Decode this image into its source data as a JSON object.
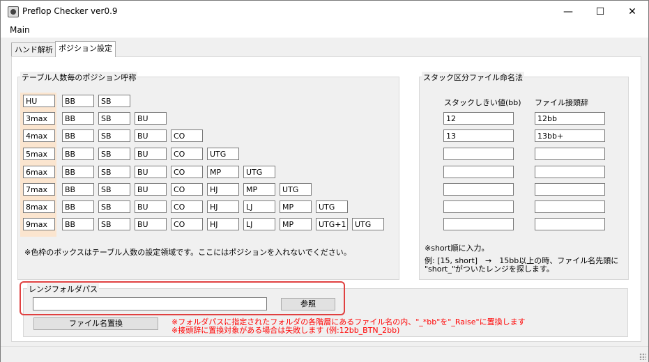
{
  "window": {
    "title": "Preflop Checker ver0.9",
    "minimize": "—",
    "maximize": "☐",
    "close": "✕"
  },
  "menu": {
    "main": "Main"
  },
  "tabs": [
    {
      "label": "ハンド解析"
    },
    {
      "label": "ポジション設定"
    }
  ],
  "positions": {
    "legend": "テーブル人数毎のポジション呼称",
    "rows": [
      {
        "key": "HU",
        "positions": [
          "BB",
          "SB"
        ]
      },
      {
        "key": "3max",
        "positions": [
          "BB",
          "SB",
          "BU"
        ]
      },
      {
        "key": "4max",
        "positions": [
          "BB",
          "SB",
          "BU",
          "CO"
        ]
      },
      {
        "key": "5max",
        "positions": [
          "BB",
          "SB",
          "BU",
          "CO",
          "UTG"
        ]
      },
      {
        "key": "6max",
        "positions": [
          "BB",
          "SB",
          "BU",
          "CO",
          "MP",
          "UTG"
        ]
      },
      {
        "key": "7max",
        "positions": [
          "BB",
          "SB",
          "BU",
          "CO",
          "HJ",
          "MP",
          "UTG"
        ]
      },
      {
        "key": "8max",
        "positions": [
          "BB",
          "SB",
          "BU",
          "CO",
          "HJ",
          "LJ",
          "MP",
          "UTG"
        ]
      },
      {
        "key": "9max",
        "positions": [
          "BB",
          "SB",
          "BU",
          "CO",
          "HJ",
          "LJ",
          "MP",
          "UTG+1",
          "UTG"
        ]
      }
    ],
    "note": "※色枠のボックスはテーブル人数の設定領域です。ここにはポジションを入れないでください。",
    "highlight_color": "#fbe5cf"
  },
  "stack": {
    "legend": "スタック区分ファイル命名法",
    "col1_header": "スタックしきい値(bb)",
    "col2_header": "ファイル接頭辞",
    "rows": [
      {
        "threshold": "12",
        "prefix": "12bb"
      },
      {
        "threshold": "13",
        "prefix": "13bb+"
      },
      {
        "threshold": "",
        "prefix": ""
      },
      {
        "threshold": "",
        "prefix": ""
      },
      {
        "threshold": "",
        "prefix": ""
      },
      {
        "threshold": "",
        "prefix": ""
      },
      {
        "threshold": "",
        "prefix": ""
      }
    ],
    "note1": "※short順に入力。",
    "note2": "例: [15, short]　→　15bb以上の時、ファイル名先頭に",
    "note3": "\"short_\"がついたレンジを探します。"
  },
  "folder": {
    "legend": "レンジフォルダパス",
    "path_value": "",
    "browse_label": "参照",
    "rename_label": "ファイル名置換",
    "warning1": "※フォルダパスに指定されたフォルダの各階層にあるファイル名の内、\"_*bb\"を\"_Raise\"に置換します",
    "warning2": "※接頭辞に置換対象がある場合は失敗します (例:12bb_BTN_2bb)",
    "highlight_color": "#e04040"
  }
}
